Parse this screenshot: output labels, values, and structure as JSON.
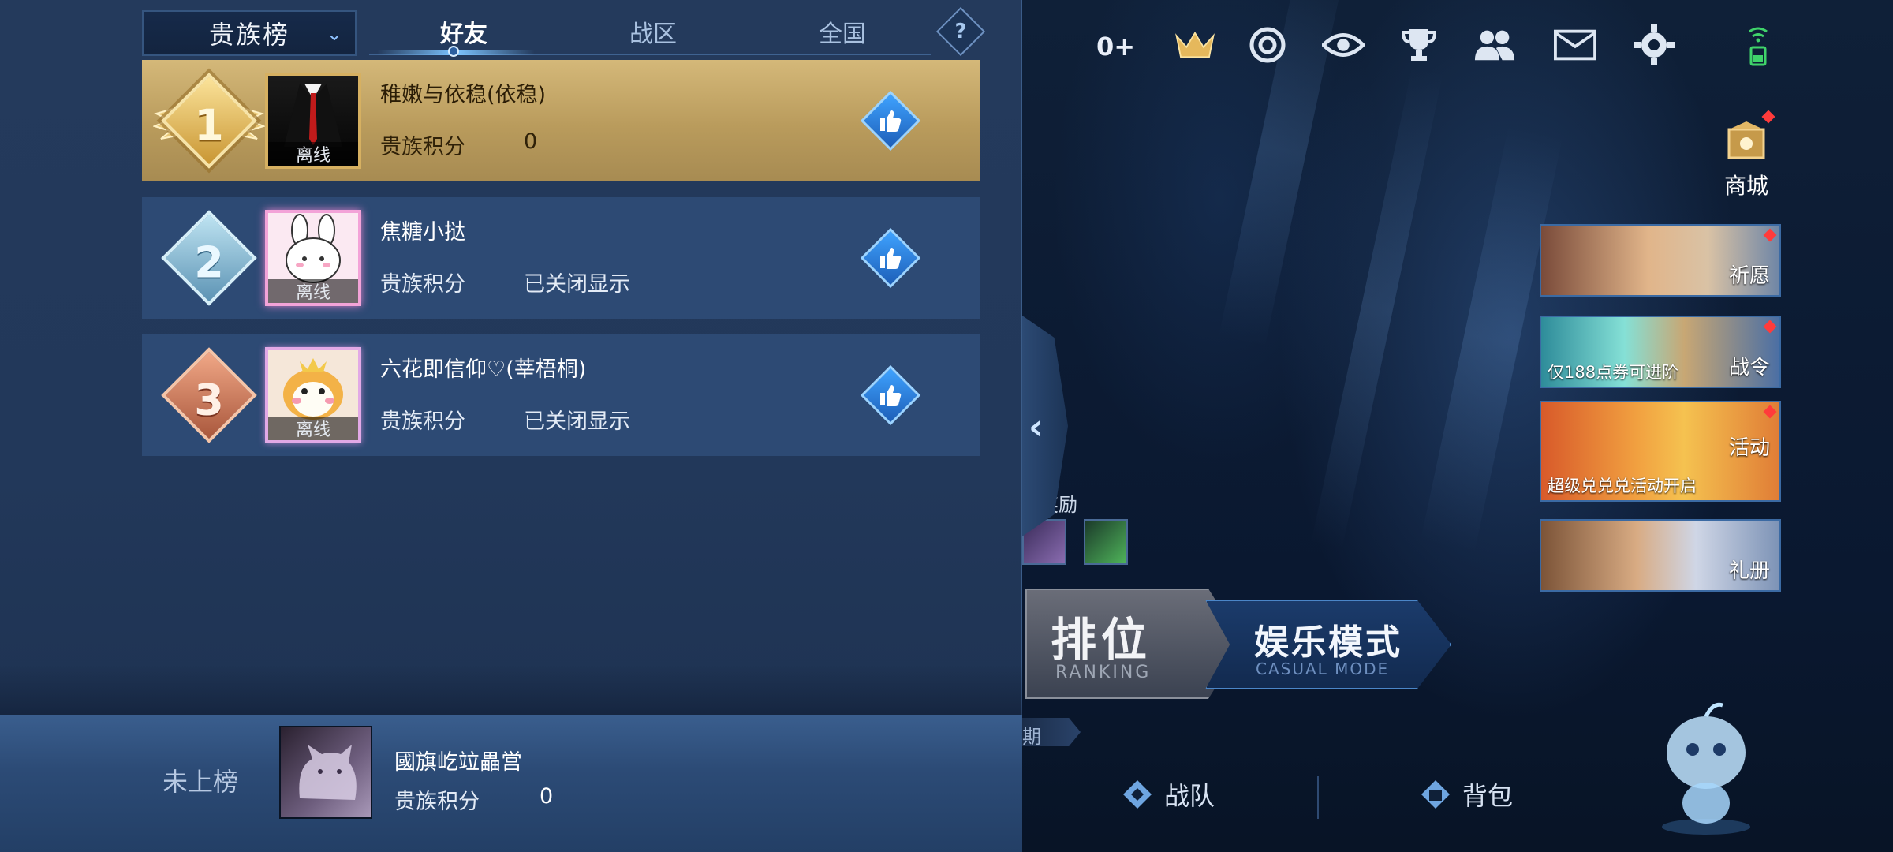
{
  "leaderboard": {
    "dropdown_label": "贵族榜",
    "tabs": [
      {
        "label": "好友",
        "active": true
      },
      {
        "label": "战区",
        "active": false
      },
      {
        "label": "全国",
        "active": false
      }
    ],
    "help_label": "?",
    "score_label": "贵族积分",
    "rows": [
      {
        "rank": "1",
        "name": "稚嫩与依稳(依稳)",
        "status": "离线",
        "score": "0"
      },
      {
        "rank": "2",
        "name": "焦糖小挞",
        "status": "离线",
        "score": "已关闭显示"
      },
      {
        "rank": "3",
        "name": "六花即信仰♡(莘梧桐)",
        "status": "离线",
        "score": "已关闭显示"
      }
    ],
    "self": {
      "rank_text": "未上榜",
      "name": "國旗屹竝畾営",
      "score_label": "贵族积分",
      "score": "0"
    }
  },
  "lobby": {
    "plus_counter": "0+",
    "shop_label": "商城",
    "cards": [
      {
        "caption": "",
        "side_label": "祈愿"
      },
      {
        "caption": "仅188点券可进阶",
        "side_label": "战令"
      },
      {
        "caption": "超级兑兑兑活动开启",
        "side_label": "活动"
      },
      {
        "caption": "",
        "side_label": "礼册"
      }
    ],
    "reward_label": "奖励",
    "mode_rank": {
      "big": "排位",
      "small": "RANKING"
    },
    "mode_casual": {
      "big": "娱乐模式",
      "small": "CASUAL MODE"
    },
    "dim_badge": "期",
    "bottom_links": [
      {
        "label": "战队"
      },
      {
        "label": "背包"
      }
    ]
  },
  "colors": {
    "panel_bg": "#22385a",
    "first_row_gold": "#c6aa6a",
    "row_bg": "#2d4a74",
    "accent_blue": "#7cc4ff"
  }
}
